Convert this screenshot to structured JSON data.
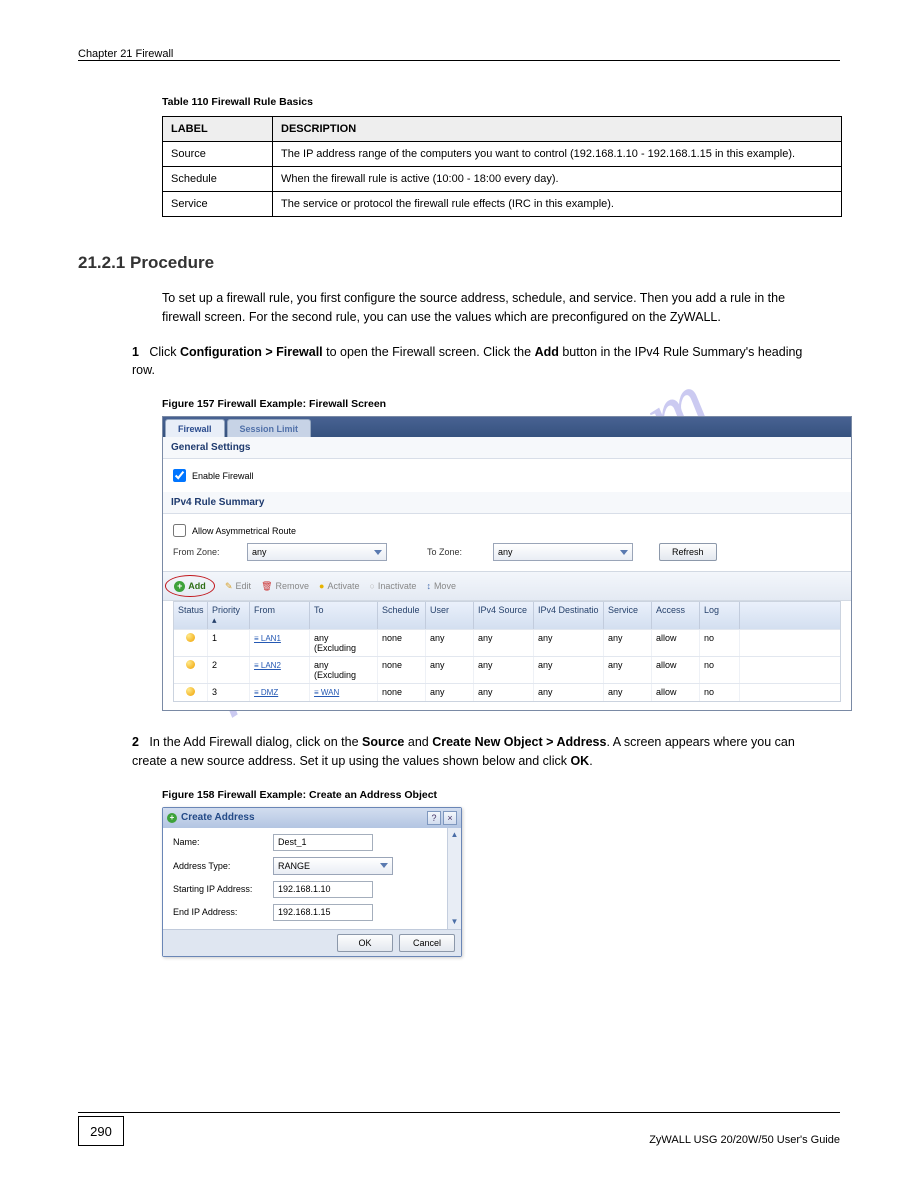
{
  "header": {
    "chapter_info": "Chapter 21 Firewall"
  },
  "labels_table": {
    "caption_prefix": "Table 110   ",
    "caption": "Firewall Rule Basics",
    "h_label": "LABEL",
    "h_desc": "DESCRIPTION",
    "rows": [
      {
        "label": "Source",
        "desc": "The IP address range of the computers you want to control (192.168.1.10 - 192.168.1.15 in this example)."
      },
      {
        "label": "Schedule",
        "desc": "When the firewall rule is active (10:00 - 18:00 every day)."
      },
      {
        "label": "Service",
        "desc": "The service or protocol the firewall rule effects (IRC in this example)."
      }
    ]
  },
  "section": {
    "num": "21.2.1  ",
    "title": "Procedure"
  },
  "para_intro": "To set up a firewall rule, you first configure the source address, schedule, and service. Then you add a rule in the firewall screen. For the second rule, you can use the values which are preconfigured on the ZyWALL.",
  "step1": {
    "num": "1",
    "text1": "Click ",
    "b1": "Configuration > Firewall",
    "text2": " to open the Firewall screen. Click the ",
    "b2": "Add",
    "text3": " button in the IPv4 Rule Summary's heading row."
  },
  "fig157_caption": "Figure 157   Firewall Example: Firewall Screen",
  "firewall": {
    "tabs": {
      "active": "Firewall",
      "inactive": "Session Limit"
    },
    "section1": "General Settings",
    "enable_chk": "Enable Firewall",
    "section2": "IPv4 Rule Summary",
    "asym_chk": "Allow Asymmetrical Route",
    "from_zone_lbl": "From Zone:",
    "to_zone_lbl": "To Zone:",
    "any": "any",
    "refresh": "Refresh",
    "toolbar": {
      "add": "Add",
      "edit": "Edit",
      "remove": "Remove",
      "activate": "Activate",
      "inactivate": "Inactivate",
      "move": "Move"
    },
    "cols": {
      "status": "Status",
      "priority": "Priority ▴",
      "from": "From",
      "to": "To",
      "schedule": "Schedule",
      "user": "User",
      "ipsrc": "IPv4 Source",
      "ipdst": "IPv4 Destinatio",
      "service": "Service",
      "access": "Access",
      "log": "Log"
    },
    "rows": [
      {
        "p": "1",
        "from": "≡ LAN1",
        "to": "any (Excluding",
        "sched": "none",
        "user": "any",
        "ips": "any",
        "ipd": "any",
        "svc": "any",
        "acc": "allow",
        "log": "no"
      },
      {
        "p": "2",
        "from": "≡ LAN2",
        "to": "any (Excluding",
        "sched": "none",
        "user": "any",
        "ips": "any",
        "ipd": "any",
        "svc": "any",
        "acc": "allow",
        "log": "no"
      },
      {
        "p": "3",
        "from": "≡ DMZ",
        "to": "≡ WAN",
        "sched": "none",
        "user": "any",
        "ips": "any",
        "ipd": "any",
        "svc": "any",
        "acc": "allow",
        "log": "no"
      }
    ]
  },
  "step2": {
    "num": "2",
    "text1": "In the Add Firewall dialog, click on the ",
    "b1": "Source",
    "text2": " and ",
    "b2": "Create New Object > Address",
    "text3": ". A screen appears where you can create a new source address. Set it up using the values shown below and click ",
    "b3": "OK",
    "text4": "."
  },
  "fig158_caption": "Figure 158   Firewall Example: Create an Address Object",
  "dialog": {
    "title": "Create Address",
    "fields": {
      "name_lbl": "Name:",
      "name_val": "Dest_1",
      "type_lbl": "Address Type:",
      "type_val": "RANGE",
      "start_lbl": "Starting IP Address:",
      "start_val": "192.168.1.10",
      "end_lbl": "End IP Address:",
      "end_val": "192.168.1.15"
    },
    "ok": "OK",
    "cancel": "Cancel"
  },
  "watermark": "manualshive.com",
  "footer": {
    "page": "290",
    "doc": "ZyWALL USG 20/20W/50 User's Guide"
  }
}
